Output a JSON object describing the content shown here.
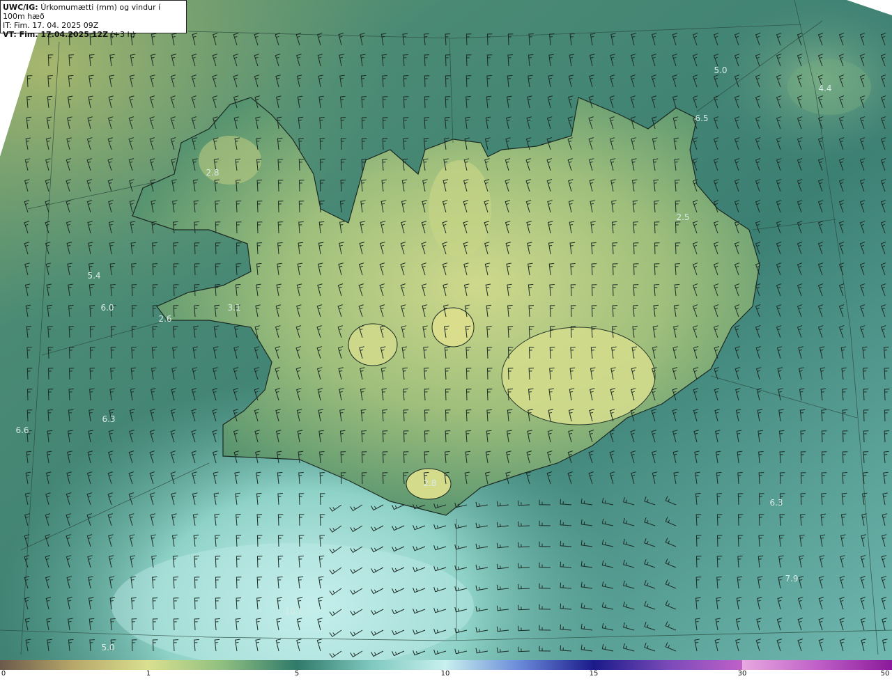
{
  "title": {
    "model": "UWC/IG:",
    "description": "Úrkomumætti (mm) og vindur í 100m hæð",
    "issue_time": "IT: Fim. 17. 04. 2025 09Z",
    "valid_time": "VT: Fim. 17.04.2025 12Z",
    "valid_offset": "(+3 h)"
  },
  "map": {
    "field": "precipitable water",
    "units": "mm",
    "overlay": "wind barbs at 100 m",
    "value_labels": [
      "2.8",
      "5.0",
      "4.4",
      "6.5",
      "2.5",
      "5.4",
      "6.0",
      "2.6",
      "3.1",
      "6.6",
      "6.3",
      "2.8",
      "6.3",
      "7.9",
      "10.1",
      "5.0"
    ]
  },
  "colorbar": {
    "ticks": [
      "0",
      "1",
      "5",
      "10",
      "15",
      "30",
      "50"
    ],
    "colors": [
      "#6b5a4a",
      "#d9e08f",
      "#2f7a6a",
      "#c8f0ee",
      "#1a1a8a",
      "#c060c8",
      "#8a1a9a"
    ]
  }
}
